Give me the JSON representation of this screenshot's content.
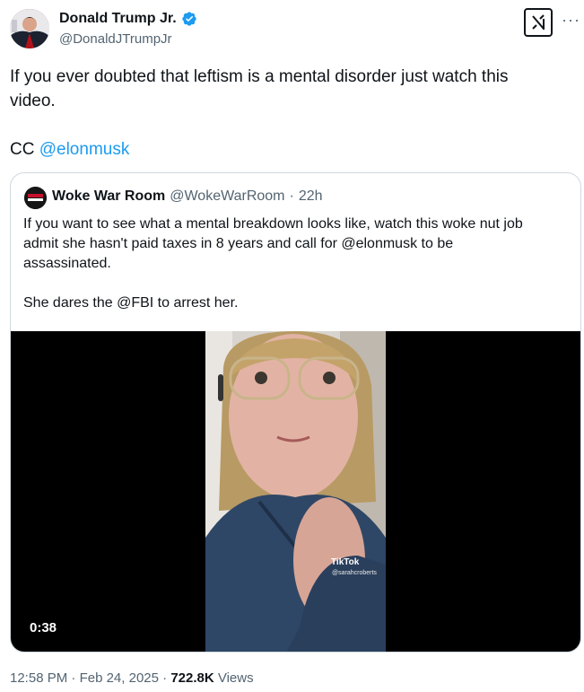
{
  "author": {
    "display_name": "Donald Trump Jr.",
    "handle": "@DonaldJTrumpJr",
    "verified_color": "#1d9bf0"
  },
  "tweet": {
    "line1": "If you ever doubted that leftism is a mental disorder just watch this",
    "line2": "video.",
    "cc_prefix": "CC ",
    "cc_mention": "@elonmusk"
  },
  "quote": {
    "display_name": "Woke War Room",
    "handle": "@WokeWarRoom",
    "separator": "·",
    "time": "22h",
    "line1": "If you want to see what a mental breakdown looks like, watch this woke nut job",
    "line2": "admit she hasn't paid taxes in 8 years and call for @elonmusk to be",
    "line3": "assassinated.",
    "line4": "She dares the @FBI to arrest her.",
    "video": {
      "duration": "0:38",
      "watermark": "TikTok",
      "watermark_user": "@sarahcroberts"
    }
  },
  "footer": {
    "time": "12:58 PM",
    "dot1": " · ",
    "date": "Feb 24, 2025",
    "dot2": " · ",
    "views_count": "722.8K",
    "views_label": " Views"
  },
  "icons": {
    "grok": "grok-icon",
    "more": "more-icon",
    "verified": "verified-badge-icon"
  },
  "colors": {
    "accent": "#1d9bf0",
    "secondary_text": "#536471",
    "border": "#cfd9de"
  }
}
